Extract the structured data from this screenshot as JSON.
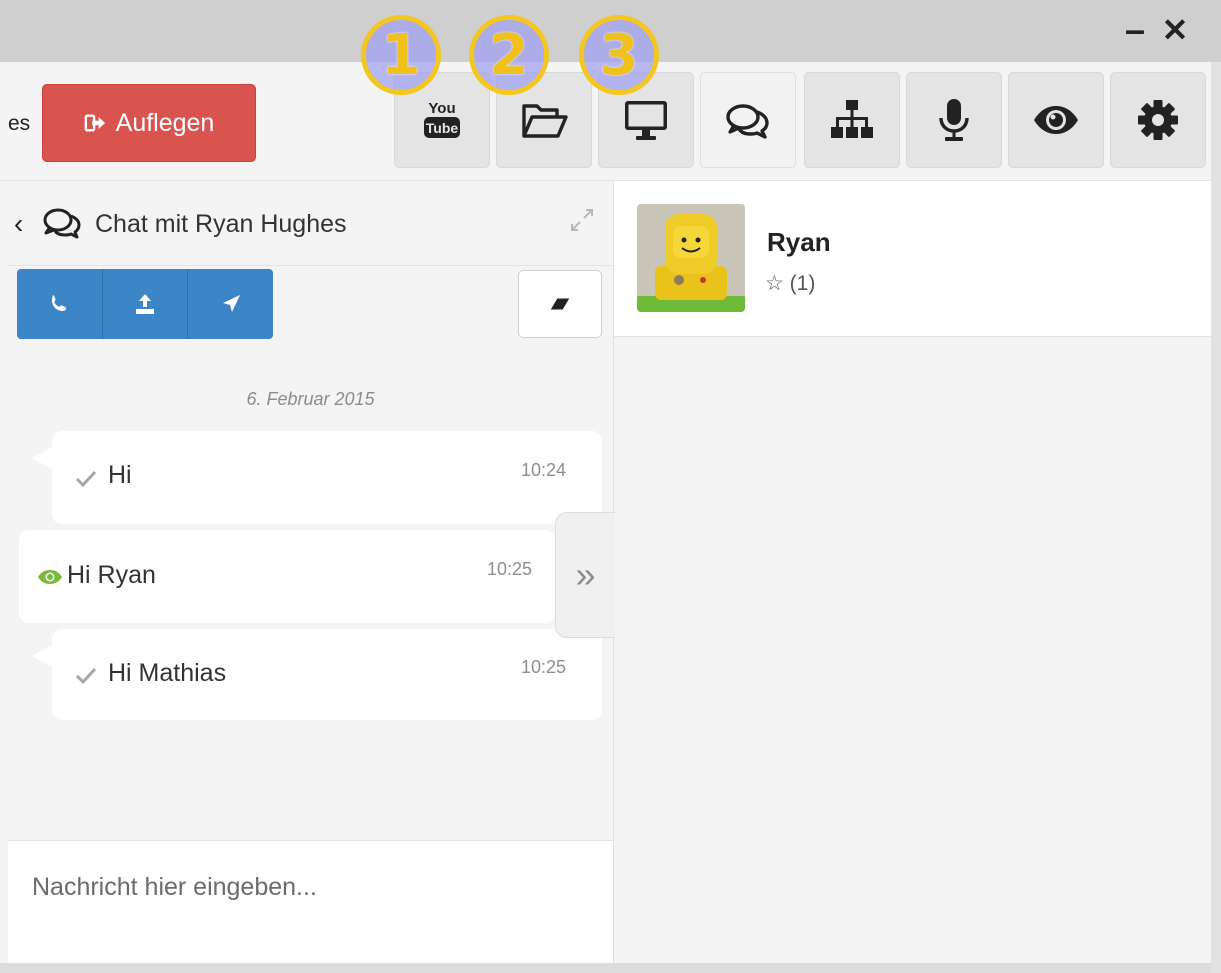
{
  "window": {
    "minimize": "–",
    "close": "✕"
  },
  "header": {
    "name_fragment": "es",
    "hangup_label": "Auflegen",
    "tools": [
      {
        "name": "youtube",
        "icon": "youtube-icon"
      },
      {
        "name": "files",
        "icon": "folder-open-icon"
      },
      {
        "name": "screen",
        "icon": "monitor-icon"
      },
      {
        "name": "chat",
        "icon": "comments-icon",
        "active": true
      },
      {
        "name": "sitemap",
        "icon": "sitemap-icon"
      },
      {
        "name": "microphone",
        "icon": "microphone-icon"
      },
      {
        "name": "view",
        "icon": "eye-icon"
      },
      {
        "name": "settings",
        "icon": "gear-icon"
      }
    ],
    "markers": [
      "1",
      "2",
      "3"
    ]
  },
  "chat": {
    "back": "‹",
    "title": "Chat mit Ryan Hughes",
    "date": "6. Februar 2015",
    "collapse": "»",
    "messages": [
      {
        "text": "Hi",
        "time": "10:24",
        "direction": "incoming",
        "status_icon": "check-icon"
      },
      {
        "text": "Hi Ryan",
        "time": "10:25",
        "direction": "outgoing",
        "status_icon": "eye-icon"
      },
      {
        "text": "Hi Mathias",
        "time": "10:25",
        "direction": "incoming",
        "status_icon": "check-icon"
      }
    ],
    "input_placeholder": "Nachricht hier eingeben..."
  },
  "contact": {
    "name": "Ryan",
    "rating": "☆ (1)"
  },
  "colors": {
    "hangup": "#d9534f",
    "action_blue": "#3c85c7",
    "marker_fill": "#9e9eee",
    "marker_ring": "#f3c622",
    "seen_green": "#7ab93b"
  }
}
